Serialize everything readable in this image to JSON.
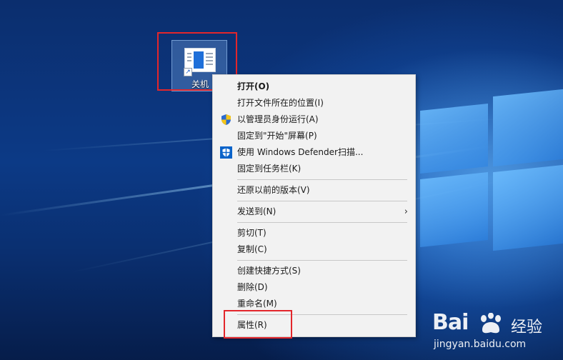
{
  "desktop": {
    "icon_label": "关机"
  },
  "context_menu": {
    "items": [
      {
        "label": "打开(O)",
        "bold": true
      },
      {
        "label": "打开文件所在的位置(I)"
      },
      {
        "label": "以管理员身份运行(A)",
        "icon": "uac-shield-icon"
      },
      {
        "label": "固定到\"开始\"屏幕(P)"
      },
      {
        "label": "使用 Windows Defender扫描...",
        "icon": "defender-shield-icon"
      },
      {
        "label": "固定到任务栏(K)"
      },
      {
        "label": "还原以前的版本(V)"
      },
      {
        "label": "发送到(N)",
        "submenu": true
      },
      {
        "label": "剪切(T)"
      },
      {
        "label": "复制(C)"
      },
      {
        "label": "创建快捷方式(S)"
      },
      {
        "label": "删除(D)"
      },
      {
        "label": "重命名(M)"
      },
      {
        "label": "属性(R)"
      }
    ],
    "submenu_arrow": "›"
  },
  "watermark": {
    "brand": "Bai",
    "brand_suffix": "经验",
    "url": "jingyan.baidu.com"
  },
  "colors": {
    "highlight_red": "#e3262b",
    "menu_bg": "#f2f2f2",
    "accent_blue": "#1e6fd9"
  }
}
